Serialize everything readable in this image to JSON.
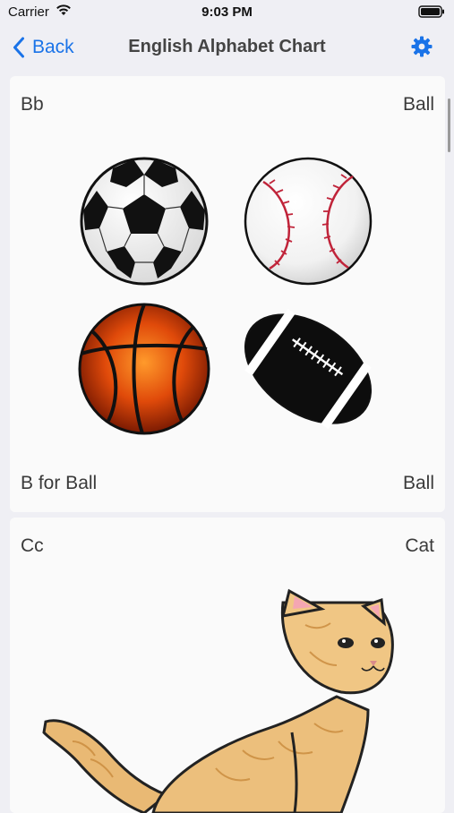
{
  "status_bar": {
    "carrier": "Carrier",
    "time": "9:03 PM",
    "icons": [
      "wifi-icon",
      "battery-icon"
    ]
  },
  "nav": {
    "back_label": "Back",
    "title": "English Alphabet Chart",
    "settings_icon": "gear-icon",
    "accent_color": "#1a73e8"
  },
  "cards": [
    {
      "letter": "Bb",
      "word_top": "Ball",
      "caption": "B for Ball",
      "word_bottom": "Ball",
      "images": [
        "soccer-ball",
        "baseball",
        "basketball",
        "american-football"
      ]
    },
    {
      "letter": "Cc",
      "word_top": "Cat",
      "images": [
        "kitten"
      ]
    }
  ]
}
